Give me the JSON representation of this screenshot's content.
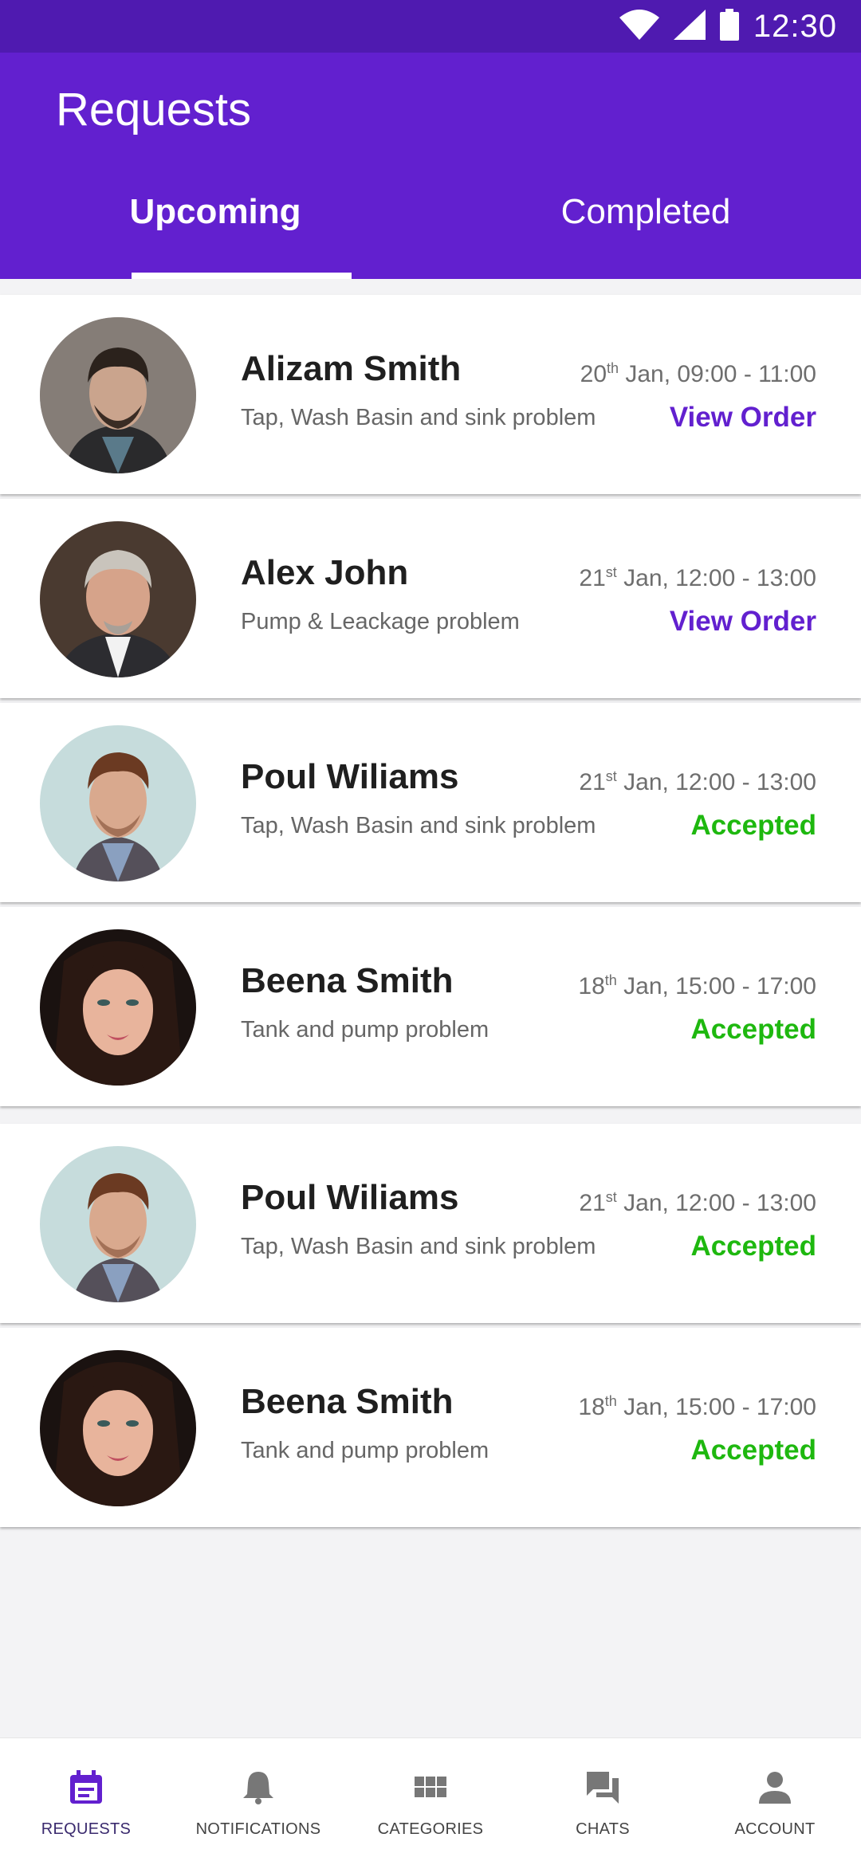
{
  "status_bar": {
    "time": "12:30"
  },
  "app_bar": {
    "title": "Requests"
  },
  "tabs": [
    {
      "label": "Upcoming",
      "active": true
    },
    {
      "label": "Completed",
      "active": false
    }
  ],
  "colors": {
    "primary": "#6220cf",
    "status_bar": "#4f1ab0",
    "accepted": "#1eb80f"
  },
  "requests": [
    {
      "name": "Alizam Smith",
      "problem": "Tap, Wash Basin and sink problem",
      "day": "20",
      "suffix": "th",
      "time_range": " Jan, 09:00 - 11:00",
      "action": "View Order",
      "action_type": "view"
    },
    {
      "name": "Alex John",
      "problem": "Pump & Leackage problem",
      "day": "21",
      "suffix": "st",
      "time_range": " Jan, 12:00 - 13:00",
      "action": "View Order",
      "action_type": "view"
    },
    {
      "name": "Poul Wiliams",
      "problem": "Tap, Wash Basin and sink problem",
      "day": "21",
      "suffix": "st",
      "time_range": " Jan, 12:00 - 13:00",
      "action": "Accepted",
      "action_type": "accepted"
    },
    {
      "name": "Beena Smith",
      "problem": "Tank and pump problem",
      "day": "18",
      "suffix": "th",
      "time_range": " Jan, 15:00 - 17:00",
      "action": "Accepted",
      "action_type": "accepted"
    },
    {
      "name": "Poul Wiliams",
      "problem": "Tap, Wash Basin and sink problem",
      "day": "21",
      "suffix": "st",
      "time_range": " Jan, 12:00 - 13:00",
      "action": "Accepted",
      "action_type": "accepted"
    },
    {
      "name": "Beena Smith",
      "problem": "Tank and pump problem",
      "day": "18",
      "suffix": "th",
      "time_range": " Jan, 15:00 - 17:00",
      "action": "Accepted",
      "action_type": "accepted"
    }
  ],
  "bottom_nav": [
    {
      "label": "REQUESTS",
      "icon": "calendar-icon",
      "active": true
    },
    {
      "label": "NOTIFICATIONS",
      "icon": "bell-icon",
      "active": false
    },
    {
      "label": "CATEGORIES",
      "icon": "grid-icon",
      "active": false
    },
    {
      "label": "CHATS",
      "icon": "chat-icon",
      "active": false
    },
    {
      "label": "ACCOUNT",
      "icon": "person-icon",
      "active": false
    }
  ]
}
